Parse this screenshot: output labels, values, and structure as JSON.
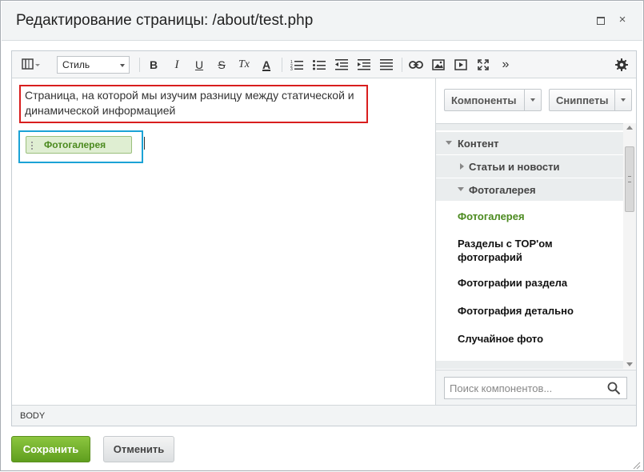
{
  "dialog": {
    "title": "Редактирование страницы: /about/test.php",
    "close_glyph": "×"
  },
  "toolbar": {
    "style_select_value": "Стиль",
    "bold": "B",
    "italic": "I",
    "underline": "U",
    "strike": "S",
    "remove_format": "Tx",
    "font_color": "A",
    "more": "»"
  },
  "content": {
    "paragraph": "Страница, на которой мы изучим разницу между статической и динамической информацией",
    "component_label": "Фотогалерея"
  },
  "sidebar": {
    "components_button": "Компоненты",
    "snippets_button": "Сниппеты",
    "tree": {
      "group": "Контент",
      "sub_collapsed": "Статьи и новости",
      "sub_expanded": "Фотогалерея",
      "items": [
        {
          "label": "Фотогалерея",
          "active": true
        },
        {
          "label": "Разделы с TOP'ом фотографий",
          "active": false
        },
        {
          "label": "Фотографии раздела",
          "active": false
        },
        {
          "label": "Фотография детально",
          "active": false
        },
        {
          "label": "Случайное фото",
          "active": false
        }
      ]
    },
    "search_placeholder": "Поиск компонентов..."
  },
  "statusbar": {
    "path": "BODY"
  },
  "footer": {
    "save_label": "Сохранить",
    "cancel_label": "Отменить"
  },
  "colors": {
    "accent_green": "#5f9e1e",
    "paragraph_border": "#d91e1e",
    "component_border": "#1ba3d6",
    "active_item": "#4b8a1f"
  }
}
